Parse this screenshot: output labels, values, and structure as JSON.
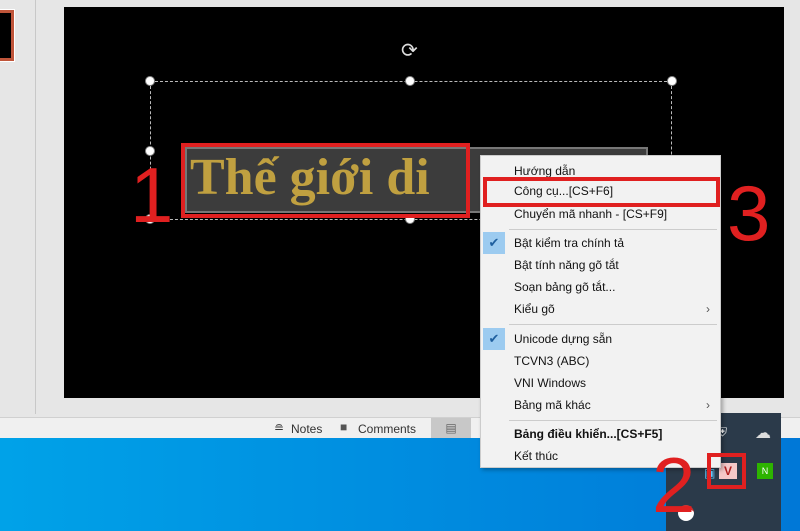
{
  "slide": {
    "text": "Thế giới di"
  },
  "annotations": [
    "1",
    "2",
    "3"
  ],
  "statusbar": {
    "notes": "Notes",
    "comments": "Comments"
  },
  "menu": {
    "items": [
      {
        "label": "Hướng dẫn"
      },
      {
        "label": "Công cụ...[CS+F6]",
        "highlighted": true
      },
      {
        "label": "Chuyển mã nhanh - [CS+F9]"
      },
      {
        "label": "Bật kiểm tra chính tả",
        "checked": true
      },
      {
        "label": "Bật tính năng gõ tắt"
      },
      {
        "label": "Soạn bảng gõ tắt..."
      },
      {
        "label": "Kiểu gõ",
        "submenu": true
      },
      {
        "label": "Unicode dựng sẵn",
        "checked": true
      },
      {
        "label": "TCVN3 (ABC)"
      },
      {
        "label": "VNI Windows"
      },
      {
        "label": "Bảng mã khác",
        "submenu": true
      },
      {
        "label": "Bảng điều khiển...[CS+F5]",
        "bold": true
      },
      {
        "label": "Kết thúc"
      }
    ]
  },
  "tray": {
    "unikey_label": "V",
    "line_badge": "N"
  },
  "colors": {
    "annotation": "#e02020",
    "text_gold": "#c0a040",
    "taskbar": "#0078d7"
  }
}
